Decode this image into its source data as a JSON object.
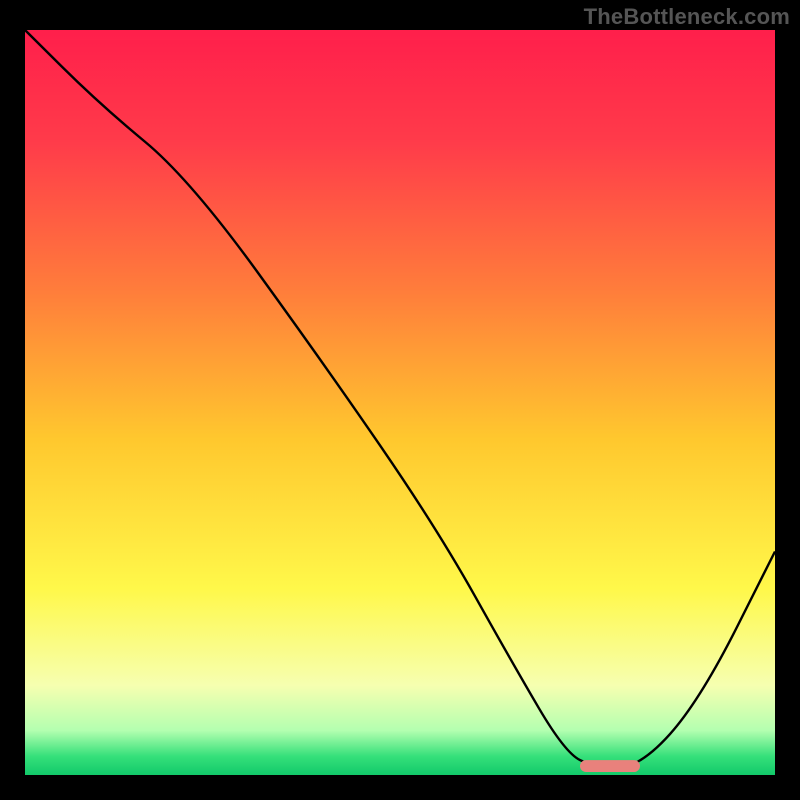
{
  "watermark": "TheBottleneck.com",
  "chart_data": {
    "type": "line",
    "title": "",
    "xlabel": "",
    "ylabel": "",
    "xlim": [
      0,
      100
    ],
    "ylim": [
      0,
      100
    ],
    "grid": false,
    "legend": false,
    "background_gradient_stops": [
      {
        "offset": 0.0,
        "color": "#ff1f4b"
      },
      {
        "offset": 0.15,
        "color": "#ff3b4a"
      },
      {
        "offset": 0.35,
        "color": "#ff7d3b"
      },
      {
        "offset": 0.55,
        "color": "#ffc82e"
      },
      {
        "offset": 0.75,
        "color": "#fff84a"
      },
      {
        "offset": 0.88,
        "color": "#f6ffb0"
      },
      {
        "offset": 0.94,
        "color": "#b4ffb0"
      },
      {
        "offset": 0.975,
        "color": "#35e07a"
      },
      {
        "offset": 1.0,
        "color": "#12c96a"
      }
    ],
    "series": [
      {
        "name": "bottleneck-curve",
        "x": [
          0,
          10,
          22,
          40,
          55,
          65,
          72,
          76,
          82,
          90,
          100
        ],
        "y": [
          100,
          90,
          80,
          55,
          33,
          15,
          3,
          1,
          1,
          10,
          30
        ]
      }
    ],
    "marker": {
      "name": "optimal-segment",
      "x_start": 74,
      "x_end": 82,
      "y": 1.2,
      "color": "#e9817c",
      "thickness_pct": 1.6
    }
  }
}
